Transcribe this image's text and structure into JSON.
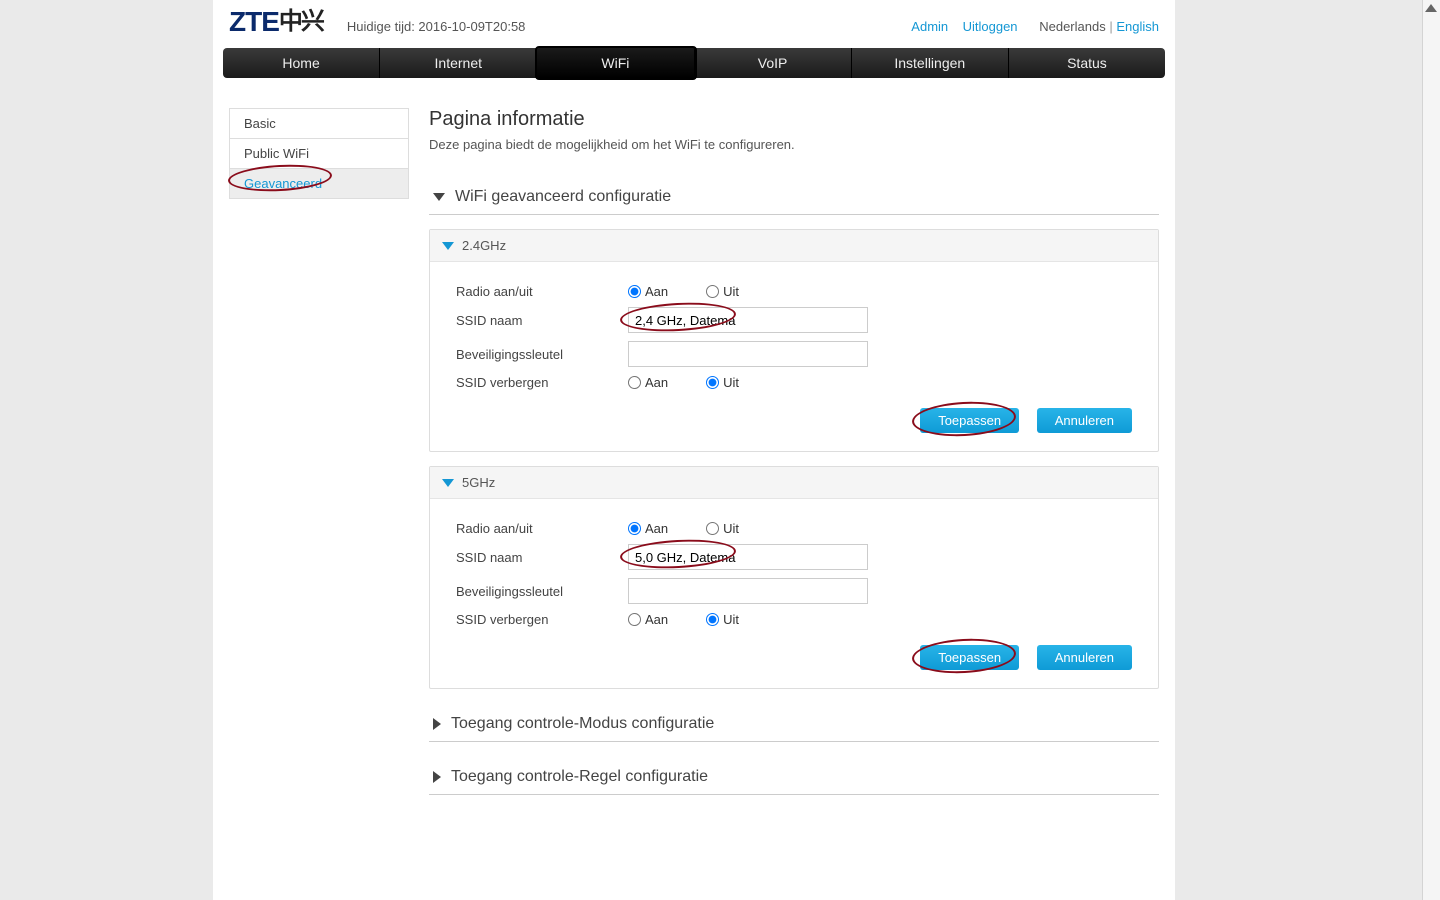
{
  "header": {
    "timestamp_label": "Huidige tijd: 2016-10-09T20:58",
    "admin": "Admin",
    "logout": "Uitloggen",
    "lang_nl": "Nederlands",
    "lang_en": "English",
    "lang_sep": "|"
  },
  "nav": {
    "home": "Home",
    "internet": "Internet",
    "wifi": "WiFi",
    "voip": "VoIP",
    "settings": "Instellingen",
    "status": "Status"
  },
  "sidebar": {
    "basic": "Basic",
    "public_wifi": "Public WiFi",
    "advanced": "Geavanceerd"
  },
  "page": {
    "title": "Pagina informatie",
    "desc": "Deze pagina biedt de mogelijkheid om het WiFi te configureren."
  },
  "sections": {
    "wifi_adv": "WiFi geavanceerd configuratie",
    "access_mode": "Toegang controle-Modus configuratie",
    "access_rule": "Toegang controle-Regel configuratie"
  },
  "labels": {
    "radio_onoff": "Radio aan/uit",
    "ssid_name": "SSID naam",
    "sec_key": "Beveiligingssleutel",
    "ssid_hide": "SSID verbergen",
    "on": "Aan",
    "off": "Uit",
    "apply": "Toepassen",
    "cancel": "Annuleren"
  },
  "panel24": {
    "title": "2.4GHz",
    "radio": "on",
    "ssid": "2,4 GHz, Datema",
    "key": "",
    "hide": "off"
  },
  "panel5": {
    "title": "5GHz",
    "radio": "on",
    "ssid": "5,0 GHz, Datema",
    "key": "",
    "hide": "off"
  }
}
